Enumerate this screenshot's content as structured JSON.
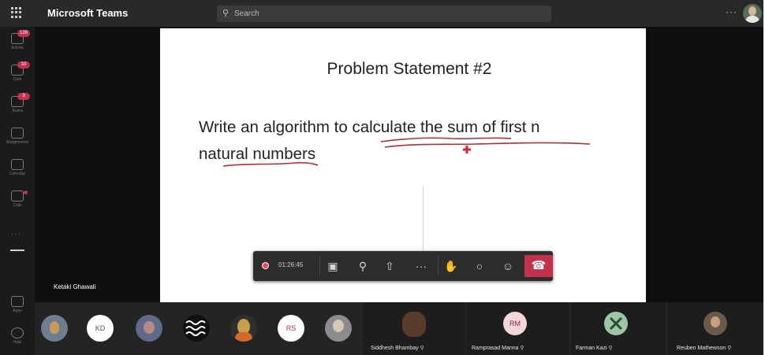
{
  "app": {
    "title": "Microsoft Teams"
  },
  "search": {
    "placeholder": "Search"
  },
  "topbar": {
    "more": "···"
  },
  "rail": [
    {
      "label": "Activity",
      "badge": "129"
    },
    {
      "label": "Chat",
      "badge": "10"
    },
    {
      "label": "Teams",
      "badge": "3"
    },
    {
      "label": "Assignments",
      "badge": ""
    },
    {
      "label": "Calendar",
      "badge": ""
    },
    {
      "label": "Calls",
      "badge": ""
    }
  ],
  "rail_bottom": {
    "more": "···",
    "apps": "Apps",
    "help": "Help"
  },
  "slide": {
    "title": "Problem Statement #2",
    "line1": "Write an algorithm to calculate the sum of first n",
    "line2": "natural numbers"
  },
  "presenter": {
    "name": "Ketaki Ghawali"
  },
  "controls": {
    "timer": "01:26:45",
    "more": "···",
    "colors": {
      "record": "#e54c5f",
      "hangup": "#c4314b"
    }
  },
  "participants": {
    "avatars": [
      {
        "initials": ""
      },
      {
        "initials": "KD"
      },
      {
        "initials": ""
      },
      {
        "initials": ""
      },
      {
        "initials": ""
      },
      {
        "initials": "RS"
      },
      {
        "initials": ""
      }
    ],
    "tiles": [
      {
        "name": "Siddhesh Bhambay",
        "initials": ""
      },
      {
        "name": "Ramprasad Manna",
        "initials": "RM"
      },
      {
        "name": "Farman Kazi",
        "initials": ""
      },
      {
        "name": "Reuben Mathewson",
        "initials": ""
      }
    ]
  }
}
